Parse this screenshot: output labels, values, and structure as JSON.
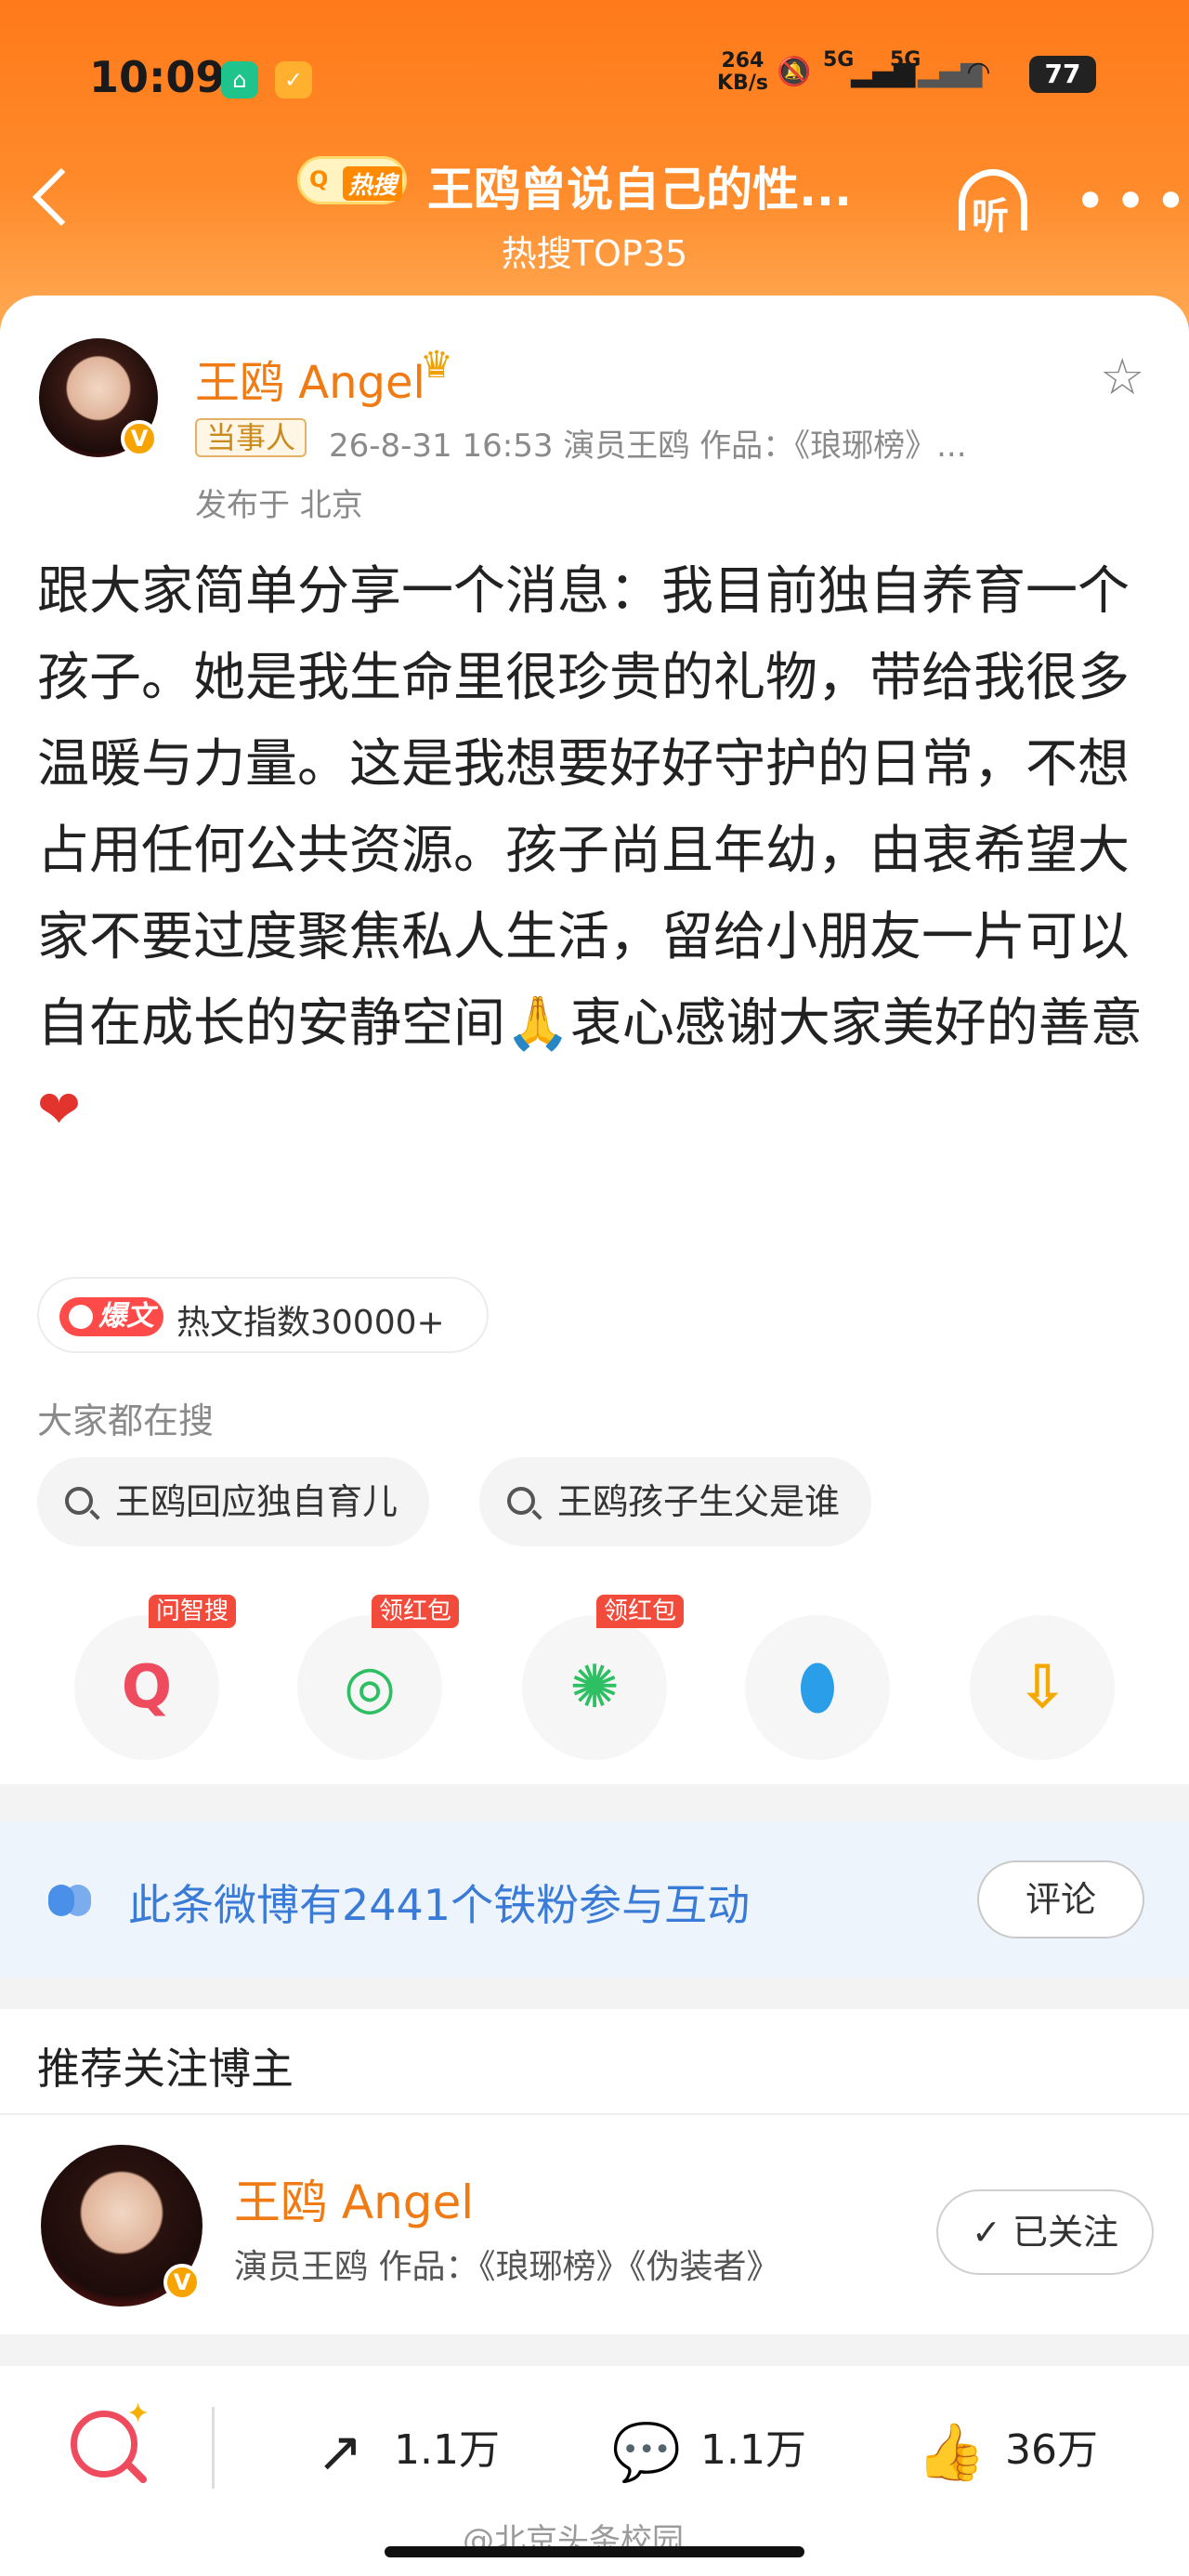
{
  "status_bar": {
    "time": "10:09",
    "net_speed_value": "264",
    "net_speed_unit": "KB/s",
    "signal1": "5G",
    "signal2": "5G",
    "battery": "77"
  },
  "nav": {
    "hot_badge": "热搜",
    "title": "王鸥曾说自己的性...",
    "subtitle": "热搜TOP35",
    "listen_label": "听"
  },
  "post": {
    "author": "王鸥 Angel",
    "role_tag": "当事人",
    "meta": "26-8-31 16:53   演员王鸥 作品：《琅琊榜》...",
    "location": "发布于 北京",
    "content": "跟大家简单分享一个消息：我目前独自养育一个孩子。她是我生命里很珍贵的礼物，带给我很多温暖与力量。这是我想要好好守护的日常，不想占用任何公共资源。孩子尚且年幼，由衷希望大家不要过度聚焦私人生活，留给小朋友一片可以自在成长的安静空间🙏衷心感谢大家美好的善意",
    "heart": "❤",
    "hot_tag": "爆文",
    "hot_index": "热文指数30000+",
    "searching_label": "大家都在搜",
    "search_chips": [
      "王鸥回应独自育儿",
      "王鸥孩子生父是谁"
    ],
    "share_items": [
      {
        "icon": "ask-search-icon",
        "label": "问智搜",
        "color": "#ef4b5f"
      },
      {
        "icon": "wechat-icon",
        "label": "领红包",
        "color": "#2dbf62"
      },
      {
        "icon": "moments-icon",
        "label": "领红包",
        "color": "#2dbf62"
      },
      {
        "icon": "qq-icon",
        "label": "",
        "color": "#2a9ee8"
      },
      {
        "icon": "save-image-icon",
        "label": "",
        "color": "#f5a800"
      }
    ]
  },
  "fans_bar": {
    "text": "此条微博有2441个铁粉参与互动",
    "button": "评论"
  },
  "recommend": {
    "title": "推荐关注博主",
    "name": "王鸥 Angel",
    "desc": "演员王鸥 作品：《琅琊榜》《伪装者》",
    "follow": "✓ 已关注"
  },
  "bottom_bar": {
    "share_count": "1.1万",
    "comment_count": "1.1万",
    "like_count": "36万"
  },
  "watermark": "@北京头条校园"
}
